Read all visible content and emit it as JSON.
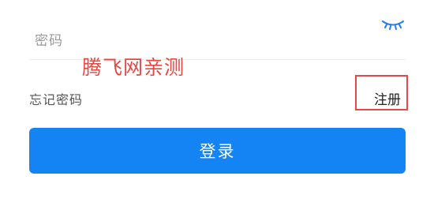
{
  "password": {
    "placeholder": "密码",
    "toggle_icon": "eye-closed-icon"
  },
  "watermark": {
    "text": "腾飞网亲测",
    "color": "#e8463f"
  },
  "forgot_password": {
    "label": "忘记密码"
  },
  "register": {
    "label": "注册",
    "highlight_color": "#e04a48"
  },
  "login": {
    "label": "登录",
    "color": "#1484f5"
  }
}
